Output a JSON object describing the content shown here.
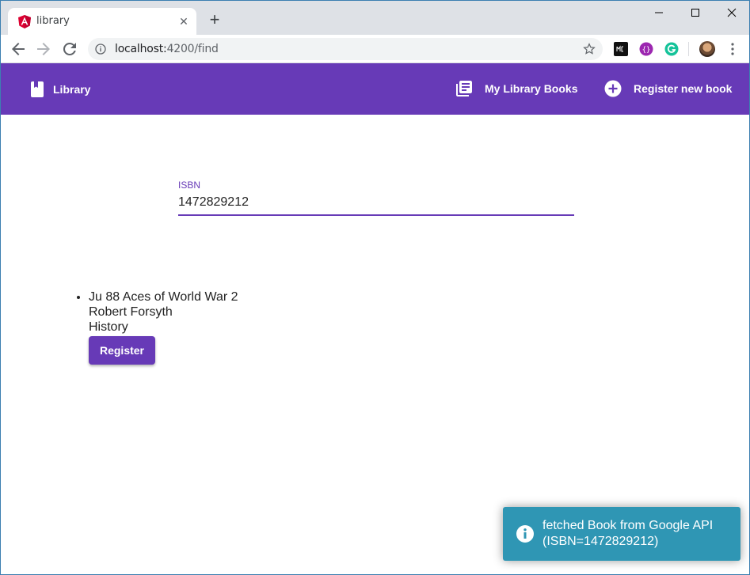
{
  "browser": {
    "tab_title": "library",
    "url_host": "localhost:",
    "url_path": "4200/find",
    "new_tab_symbol": "+",
    "tab_close_symbol": "✕"
  },
  "app_bar": {
    "brand_label": "Library",
    "nav": [
      {
        "label": "My Library Books",
        "icon": "library-books-icon"
      },
      {
        "label": "Register new book",
        "icon": "add-circle-icon"
      }
    ],
    "color": "#673ab7"
  },
  "search": {
    "label": "ISBN",
    "value": "1472829212"
  },
  "results": [
    {
      "title": "Ju 88 Aces of World War 2",
      "author": "Robert Forsyth",
      "category": "History",
      "button_label": "Register"
    }
  ],
  "toast": {
    "message": "fetched Book from Google API (ISBN=1472829212)",
    "icon": "info-icon",
    "color": "#2f96b4"
  }
}
